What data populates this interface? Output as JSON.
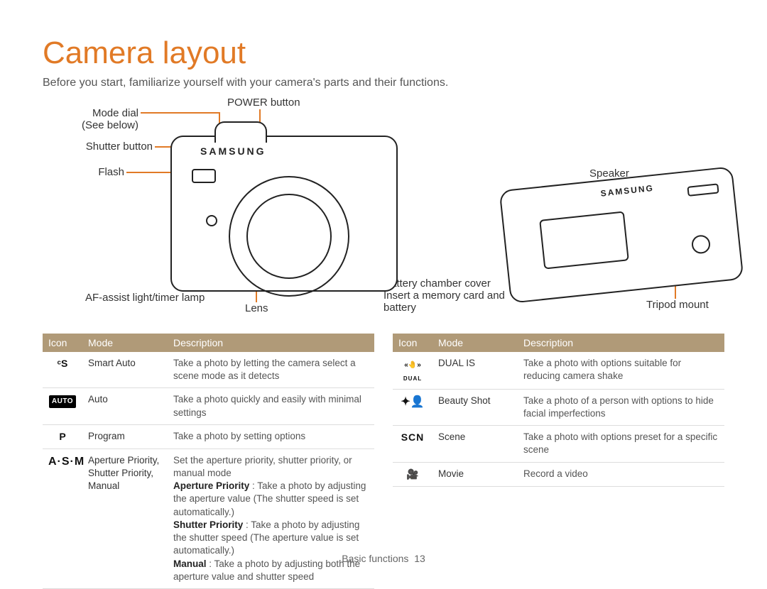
{
  "title": "Camera layout",
  "intro": "Before you start, familiarize yourself with your camera's parts and their functions.",
  "diagram": {
    "mode_dial": "Mode dial",
    "mode_dial_note": "(See below)",
    "shutter_button": "Shutter button",
    "flash": "Flash",
    "af_lamp": "AF-assist light/timer lamp",
    "lens": "Lens",
    "power_button": "POWER button",
    "speaker": "Speaker",
    "battery_cover": "Battery chamber cover",
    "battery_note": "Insert a memory card and battery",
    "tripod": "Tripod mount",
    "brand": "SAMSUNG"
  },
  "table_headers": {
    "icon": "Icon",
    "mode": "Mode",
    "description": "Description"
  },
  "left_rows": [
    {
      "icon_text": "ᶜS",
      "icon_class": "",
      "mode": "Smart Auto",
      "desc": "Take a photo by letting the camera select a scene mode as it detects"
    },
    {
      "icon_text": "AUTO",
      "icon_class": "auto-badge",
      "mode": "Auto",
      "desc": "Take a photo quickly and easily with minimal settings"
    },
    {
      "icon_text": "P",
      "icon_class": "",
      "mode": "Program",
      "desc": "Take a photo by setting options"
    },
    {
      "icon_text": "A·S·M",
      "icon_class": "asm",
      "mode": "Aperture Priority, Shutter Priority, Manual",
      "desc_pre": "Set the aperture priority, shutter priority, or manual mode",
      "desc_ap_label": "Aperture Priority",
      "desc_ap": " : Take a photo by adjusting the aperture value (The shutter speed is set automatically.)",
      "desc_sp_label": "Shutter Priority",
      "desc_sp": " : Take a photo by adjusting the shutter speed (The aperture value is set automatically.)",
      "desc_m_label": "Manual",
      "desc_m": " : Take a photo by adjusting both the aperture value and shutter speed"
    }
  ],
  "right_rows": [
    {
      "icon_text": "⁽ᵈᵘᵃˡ⁾",
      "icon_alt": "DUAL",
      "mode": "DUAL IS",
      "desc": "Take a photo with options suitable for reducing camera shake"
    },
    {
      "icon_text": "✦ᵩ",
      "mode": "Beauty Shot",
      "desc": "Take a photo of a person with options to hide facial imperfections"
    },
    {
      "icon_text": "SCN",
      "icon_class": "scn",
      "mode": "Scene",
      "desc": "Take a photo with options preset for a specific scene"
    },
    {
      "icon_text": "🎬",
      "mode": "Movie",
      "desc": "Record a video"
    }
  ],
  "footer": {
    "section": "Basic functions",
    "page": "13"
  }
}
